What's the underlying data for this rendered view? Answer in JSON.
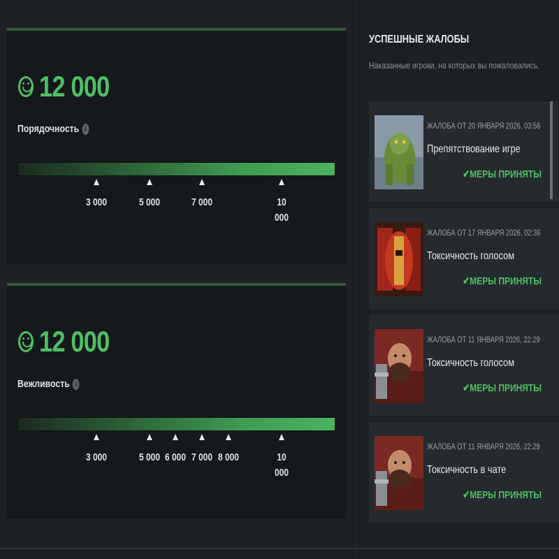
{
  "left": {
    "panels": [
      {
        "score": "12 000",
        "label": "Порядочность",
        "info_icon": "info-icon",
        "ticks": [
          "3 000",
          "5 000",
          "7 000",
          "10 000"
        ]
      },
      {
        "score": "12 000",
        "label": "Вежливость",
        "info_icon": "info-icon",
        "ticks": [
          "3 000",
          "5 000",
          "6 000",
          "7 000",
          "8 000",
          "10 000"
        ]
      }
    ]
  },
  "right": {
    "title": "УСПЕШНЫЕ ЖАЛОБЫ",
    "subtitle": "Наказанные игроки, на которых вы пожаловались.",
    "reports": [
      {
        "date": "ЖАЛОБА ОТ 20 ЯНВАРЯ 2026, 03:56",
        "reason": "Препятствование игре",
        "status": "✔МЕРЫ ПРИНЯТЫ",
        "portrait": "hero-portrait-green"
      },
      {
        "date": "ЖАЛОБА ОТ 17 ЯНВАРЯ 2026, 02:36",
        "reason": "Токсичность голосом",
        "status": "✔МЕРЫ ПРИНЯТЫ",
        "portrait": "hero-portrait-red-armor"
      },
      {
        "date": "ЖАЛОБА ОТ 11 ЯНВАРЯ 2026, 22:29",
        "reason": "Токсичность голосом",
        "status": "✔МЕРЫ ПРИНЯТЫ",
        "portrait": "hero-portrait-bearded"
      },
      {
        "date": "ЖАЛОБА ОТ 11 ЯНВАРЯ 2026, 22:29",
        "reason": "Токсичность в чате",
        "status": "✔МЕРЫ ПРИНЯТЫ",
        "portrait": "hero-portrait-bearded"
      }
    ]
  },
  "colors": {
    "accent": "#4fbf63",
    "panel": "#15191c",
    "card": "#252a2e"
  }
}
